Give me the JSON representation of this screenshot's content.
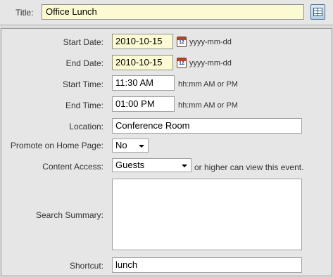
{
  "title": {
    "label": "Title:",
    "value": "Office Lunch"
  },
  "form": {
    "start_date": {
      "label": "Start Date:",
      "value": "2010-10-15",
      "format": "yyyy-mm-dd"
    },
    "end_date": {
      "label": "End Date:",
      "value": "2010-10-15",
      "format": "yyyy-mm-dd"
    },
    "calendar_icon_text": "12",
    "start_time": {
      "label": "Start Time:",
      "value": "11:30 AM",
      "format": "hh:mm AM or PM"
    },
    "end_time": {
      "label": "End Time:",
      "value": "01:00 PM",
      "format": "hh:mm AM or PM"
    },
    "location": {
      "label": "Location:",
      "value": "Conference Room"
    },
    "promote": {
      "label": "Promote on Home Page:",
      "value": "No"
    },
    "content_access": {
      "label": "Content Access:",
      "value": "Guests",
      "suffix": "or higher can view this event."
    },
    "search_summary": {
      "label": "Search Summary:",
      "value": ""
    },
    "shortcut": {
      "label": "Shortcut:",
      "value": "lunch"
    }
  }
}
